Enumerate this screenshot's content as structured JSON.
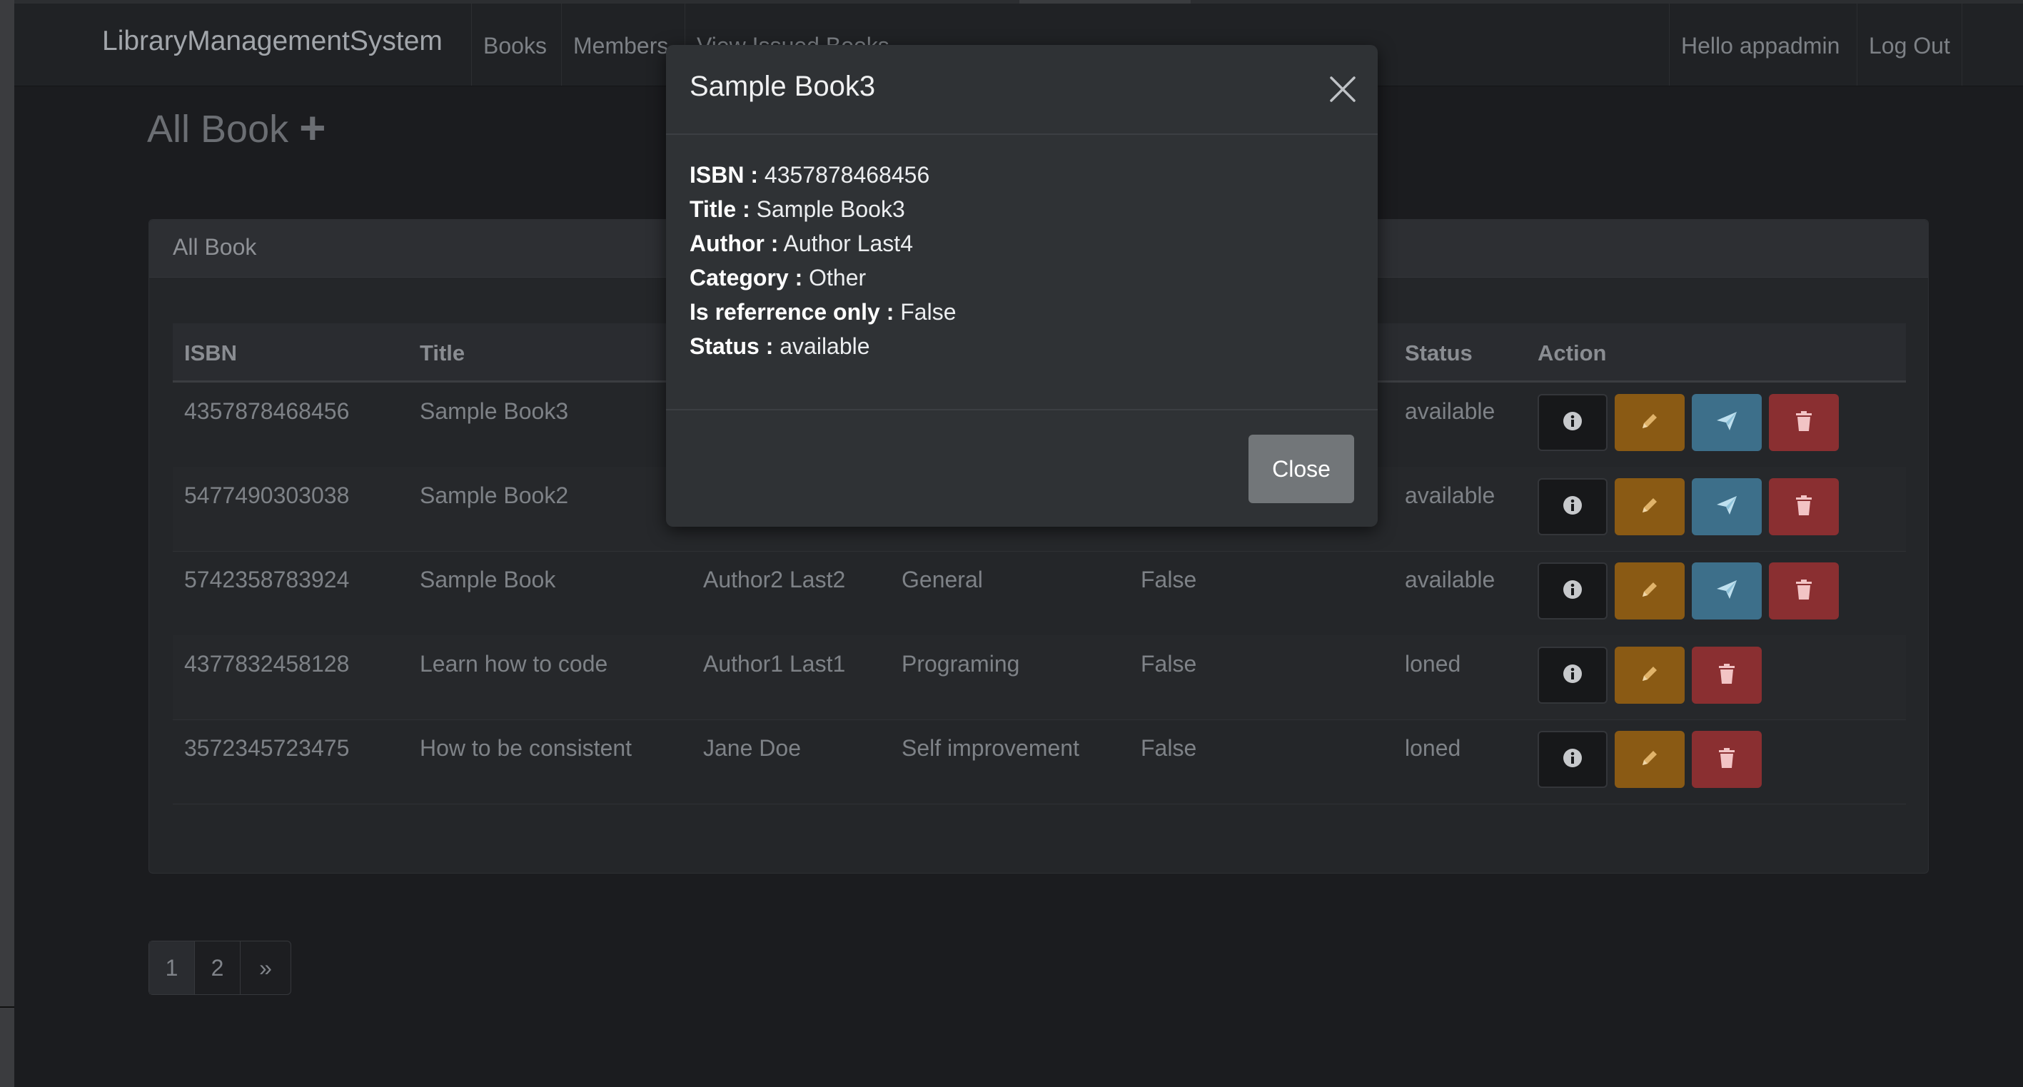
{
  "app": {
    "brand": "LibraryManagementSystem"
  },
  "nav": {
    "books": "Books",
    "members": "Members",
    "issued": "View Issued Books",
    "hello": "Hello appadmin",
    "logout": "Log Out"
  },
  "page": {
    "title": "All Book",
    "add_icon": "plus-icon"
  },
  "panel": {
    "heading": "All Book"
  },
  "table": {
    "headers": {
      "isbn": "ISBN",
      "title": "Title",
      "status": "Status",
      "action": "Action"
    },
    "rows": [
      {
        "isbn": "4357878468456",
        "title": "Sample Book3",
        "author": "",
        "category": "",
        "ref": "",
        "status": "available",
        "can_issue": true
      },
      {
        "isbn": "5477490303038",
        "title": "Sample Book2",
        "author": "",
        "category": "",
        "ref": "",
        "status": "available",
        "can_issue": true
      },
      {
        "isbn": "5742358783924",
        "title": "Sample Book",
        "author": "Author2 Last2",
        "category": "General",
        "ref": "False",
        "status": "available",
        "can_issue": true
      },
      {
        "isbn": "4377832458128",
        "title": "Learn how to code",
        "author": "Author1 Last1",
        "category": "Programing",
        "ref": "False",
        "status": "loned",
        "can_issue": false
      },
      {
        "isbn": "3572345723475",
        "title": "How to be consistent",
        "author": "Jane Doe",
        "category": "Self improvement",
        "ref": "False",
        "status": "loned",
        "can_issue": false
      }
    ]
  },
  "pagination": {
    "p1": "1",
    "p2": "2",
    "next": "»"
  },
  "modal": {
    "title": "Sample Book3",
    "fields": [
      {
        "label": "ISBN :",
        "value": "4357878468456"
      },
      {
        "label": "Title :",
        "value": "Sample Book3"
      },
      {
        "label": "Author :",
        "value": "Author Last4"
      },
      {
        "label": "Category :",
        "value": "Other"
      },
      {
        "label": "Is referrence only :",
        "value": "False"
      },
      {
        "label": "Status :",
        "value": "available"
      }
    ],
    "close_label": "Close"
  },
  "colors": {
    "edit": "#8a5a14",
    "issue": "#3d6f8a",
    "delete": "#8a2f31",
    "info": "#17181a"
  },
  "icons": {
    "info": "info-icon",
    "edit": "pencil-icon",
    "issue": "paper-plane-icon",
    "delete": "trash-icon",
    "close": "close-icon"
  }
}
